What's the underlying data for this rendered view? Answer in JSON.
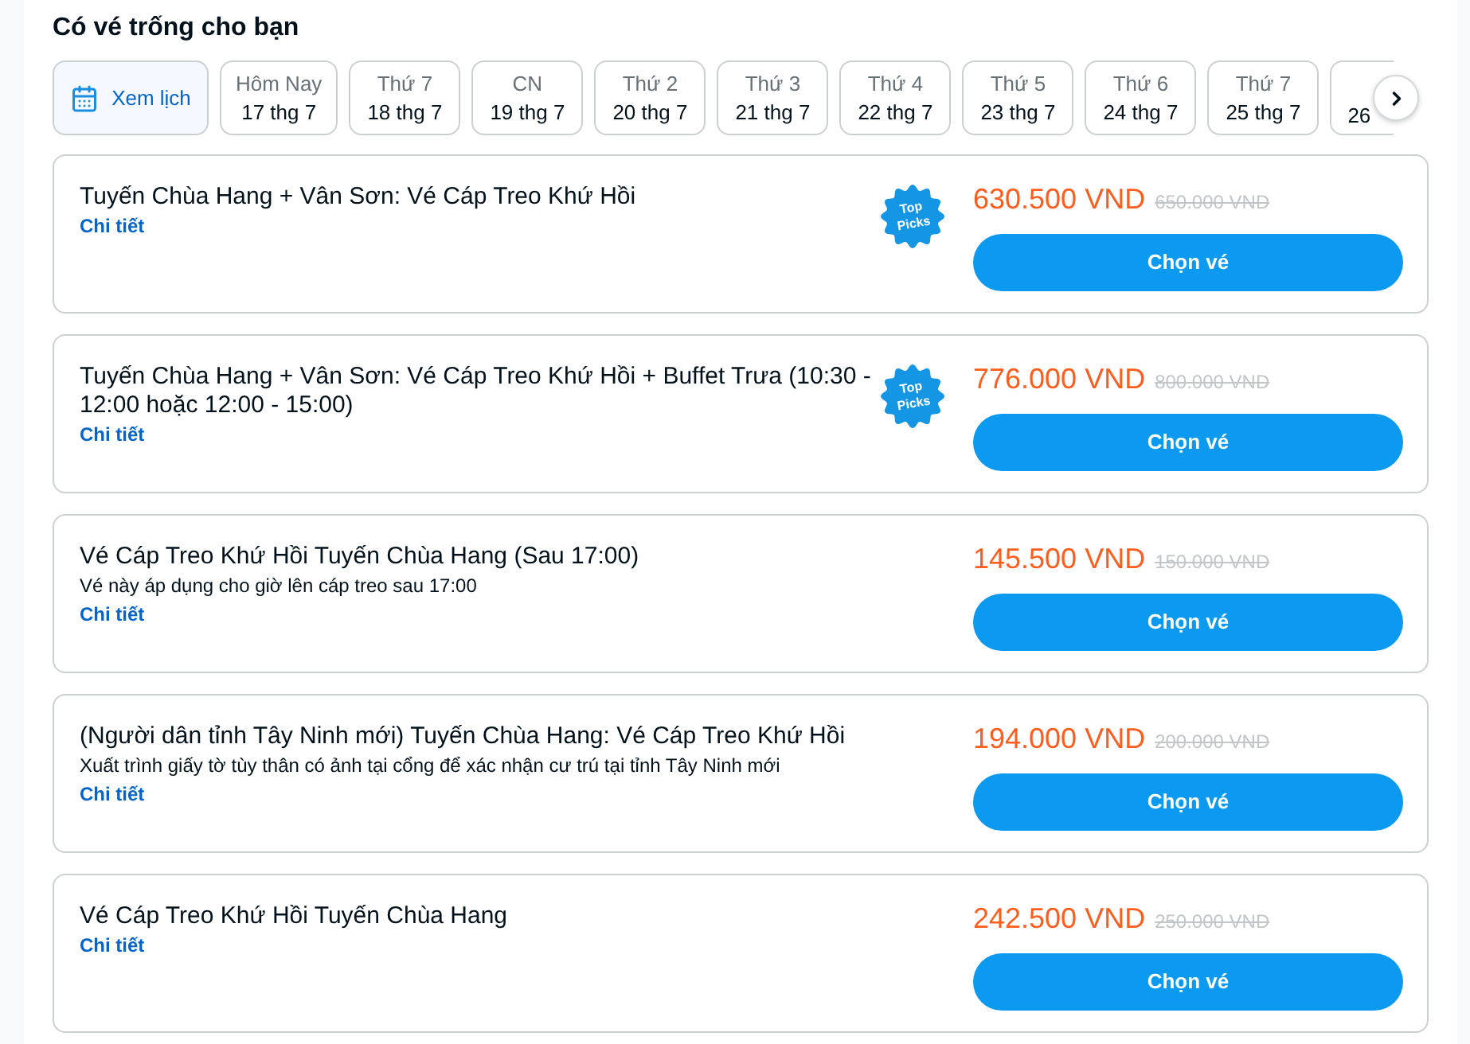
{
  "heading": "Có vé trống cho bạn",
  "calendar_button": {
    "label": "Xem lịch"
  },
  "dates": [
    {
      "kind": "full",
      "weekday": "Hôm Nay",
      "date": "17 thg 7",
      "selected": false
    },
    {
      "kind": "full",
      "weekday": "Thứ 7",
      "date": "18 thg 7",
      "selected": false
    },
    {
      "kind": "full",
      "weekday": "CN",
      "date": "19 thg 7",
      "selected": false
    },
    {
      "kind": "full",
      "weekday": "Thứ 2",
      "date": "20 thg 7",
      "selected": false
    },
    {
      "kind": "full",
      "weekday": "Thứ 3",
      "date": "21 thg 7",
      "selected": false
    },
    {
      "kind": "full",
      "weekday": "Thứ 4",
      "date": "22 thg 7",
      "selected": false
    },
    {
      "kind": "full",
      "weekday": "Thứ 5",
      "date": "23 thg 7",
      "selected": false
    },
    {
      "kind": "full",
      "weekday": "Thứ 6",
      "date": "24 thg 7",
      "selected": false
    },
    {
      "kind": "full",
      "weekday": "Thứ 7",
      "date": "25 thg 7",
      "selected": false
    },
    {
      "kind": "cut",
      "date": "26",
      "selected": false
    }
  ],
  "tickets": [
    {
      "title": "Tuyến Chùa Hang + Vân Sơn: Vé Cáp Treo Khứ Hồi",
      "details_link": "Chi tiết",
      "badge": "Top Picks",
      "price": "630.500 VND",
      "old_price": "650.000 VND",
      "button": "Chọn vé"
    },
    {
      "title": "Tuyến Chùa Hang + Vân Sơn: Vé Cáp Treo Khứ Hồi + Buffet Trưa (10:30 - 12:00 hoặc 12:00 - 15:00)",
      "details_link": "Chi tiết",
      "badge": "Top Picks",
      "price": "776.000 VND",
      "old_price": "800.000 VND",
      "button": "Chọn vé"
    },
    {
      "title": "Vé Cáp Treo Khứ Hồi Tuyến Chùa Hang (Sau 17:00)",
      "note": "Vé này áp dụng cho giờ lên cáp treo sau 17:00",
      "details_link": "Chi tiết",
      "price": "145.500 VND",
      "old_price": "150.000 VND",
      "button": "Chọn vé"
    },
    {
      "title": "(Người dân tỉnh Tây Ninh mới) Tuyến Chùa Hang: Vé Cáp Treo Khứ Hồi",
      "note": "Xuất trình giấy tờ tùy thân có ảnh tại cổng để xác nhận cư trú tại tỉnh Tây Ninh mới",
      "details_link": "Chi tiết",
      "price": "194.000 VND",
      "old_price": "200.000 VND",
      "button": "Chọn vé"
    },
    {
      "title": "Vé Cáp Treo Khứ Hồi Tuyến Chùa Hang",
      "details_link": "Chi tiết",
      "price": "242.500 VND",
      "old_price": "250.000 VND",
      "button": "Chọn vé"
    }
  ]
}
